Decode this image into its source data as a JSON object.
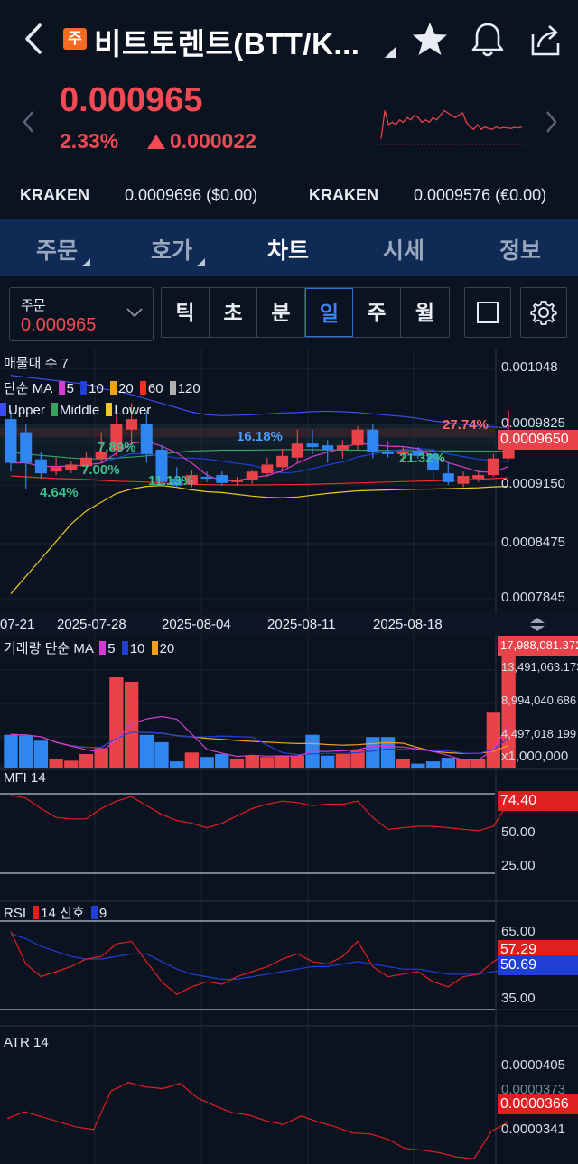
{
  "header": {
    "badge": "주",
    "title": "비트토렌트(BTT/K...",
    "price": "0.000965",
    "change_pct": "2.33%",
    "change_abs": "0.000022"
  },
  "exchanges": [
    {
      "name": "KRAKEN",
      "value": "0.0009696 ($0.00)"
    },
    {
      "name": "KRAKEN",
      "value": "0.0009576 (€0.00)"
    }
  ],
  "tabs": [
    {
      "label": "주문",
      "active": false
    },
    {
      "label": "호가",
      "active": false
    },
    {
      "label": "차트",
      "active": true
    },
    {
      "label": "시세",
      "active": false
    },
    {
      "label": "정보",
      "active": false
    }
  ],
  "order": {
    "label": "주문",
    "value": "0.000965"
  },
  "timeframes": [
    "틱",
    "초",
    "분",
    "일",
    "주",
    "월"
  ],
  "active_timeframe": "일",
  "price_panel": {
    "legend1": "매물대 수 7",
    "legend2_label": "단순 MA",
    "legend2_items": [
      {
        "n": "5",
        "color": "#d23cd0"
      },
      {
        "n": "10",
        "color": "#1f3fd6"
      },
      {
        "n": "20",
        "color": "#f0a020"
      },
      {
        "n": "60",
        "color": "#f03020"
      },
      {
        "n": "120",
        "color": "#b0b0b0"
      }
    ],
    "legend3": [
      {
        "label": "Upper",
        "color": "#3b4cf0"
      },
      {
        "label": "Middle",
        "color": "#3aa060"
      },
      {
        "label": "Lower",
        "color": "#f0c820"
      }
    ],
    "axis": [
      "0.001048",
      "0.0009825",
      "0.0009150",
      "0.0008475",
      "0.0007845"
    ],
    "current_tag": "0.0009650",
    "annotations": [
      {
        "text": "27.74%",
        "color": "#ff6a6a"
      },
      {
        "text": "16.18%",
        "color": "#4aa0ff"
      },
      {
        "text": "7.89%",
        "color": "#3cc08c"
      },
      {
        "text": "7.00%",
        "color": "#3cc08c"
      },
      {
        "text": "4.64%",
        "color": "#3cc08c"
      },
      {
        "text": "11.13%",
        "color": "#3cc08c"
      },
      {
        "text": "21.32%",
        "color": "#3cc08c"
      }
    ]
  },
  "dates": [
    "07-21",
    "2025-07-28",
    "2025-08-04",
    "2025-08-11",
    "2025-08-18"
  ],
  "volume_panel": {
    "legend_label": "거래량 단순 MA",
    "legend_items": [
      {
        "n": "5",
        "color": "#d23cd0"
      },
      {
        "n": "10",
        "color": "#1f3fd6"
      },
      {
        "n": "20",
        "color": "#f0a020"
      }
    ],
    "axis": [
      "13,491,063.173",
      "8,994,040.686",
      "4,497,018.199",
      "x1,000,000"
    ],
    "current_tag": "17,988,081.372"
  },
  "mfi_panel": {
    "legend": "MFI 14",
    "axis": [
      "50.00",
      "25.00"
    ],
    "current_tag": "74.40"
  },
  "rsi_panel": {
    "legend_label": "RSI",
    "legend_items": [
      {
        "n": "14",
        "label": "신호",
        "color": "#e02020"
      },
      {
        "n": "9",
        "label": "",
        "color": "#1f3fd6"
      }
    ],
    "axis": [
      "65.00",
      "35.00"
    ],
    "tag_rsi": "57.29",
    "tag_signal": "50.69"
  },
  "atr_panel": {
    "legend": "ATR 14",
    "axis": [
      "0.0000405",
      "0.0000341"
    ],
    "hidden_label": "0.0000373",
    "current_tag": "0.0000366"
  },
  "candles": [
    {
      "d": "07-19",
      "o": 0.00099,
      "h": 0.001,
      "l": 0.00093,
      "c": 0.00094
    },
    {
      "d": "07-20",
      "o": 0.000975,
      "h": 0.000985,
      "l": 0.00091,
      "c": 0.00094
    },
    {
      "d": "07-21",
      "o": 0.000944,
      "h": 0.000952,
      "l": 0.000922,
      "c": 0.000928
    },
    {
      "d": "07-22",
      "o": 0.00093,
      "h": 0.000946,
      "l": 0.000926,
      "c": 0.000935
    },
    {
      "d": "07-23",
      "o": 0.000932,
      "h": 0.000942,
      "l": 0.000928,
      "c": 0.000938
    },
    {
      "d": "07-24",
      "o": 0.000936,
      "h": 0.000952,
      "l": 0.00093,
      "c": 0.000946
    },
    {
      "d": "07-25",
      "o": 0.000945,
      "h": 0.000975,
      "l": 0.00094,
      "c": 0.000952
    },
    {
      "d": "07-26",
      "o": 0.000955,
      "h": 0.000995,
      "l": 0.000948,
      "c": 0.000985
    },
    {
      "d": "07-27",
      "o": 0.000978,
      "h": 0.001008,
      "l": 0.00096,
      "c": 0.00099
    },
    {
      "d": "07-28",
      "o": 0.000985,
      "h": 0.001,
      "l": 0.00094,
      "c": 0.00095
    },
    {
      "d": "07-29",
      "o": 0.000955,
      "h": 0.00096,
      "l": 0.000915,
      "c": 0.000918
    },
    {
      "d": "07-30",
      "o": 0.000922,
      "h": 0.000935,
      "l": 0.000912,
      "c": 0.000914
    },
    {
      "d": "07-31",
      "o": 0.000915,
      "h": 0.000932,
      "l": 0.000912,
      "c": 0.000926
    },
    {
      "d": "08-01",
      "o": 0.000924,
      "h": 0.00093,
      "l": 0.000918,
      "c": 0.000922
    },
    {
      "d": "08-02",
      "o": 0.000926,
      "h": 0.00093,
      "l": 0.000914,
      "c": 0.000917
    },
    {
      "d": "08-03",
      "o": 0.000918,
      "h": 0.000924,
      "l": 0.000914,
      "c": 0.00092
    },
    {
      "d": "08-04",
      "o": 0.00092,
      "h": 0.000932,
      "l": 0.000916,
      "c": 0.00093
    },
    {
      "d": "08-05",
      "o": 0.000928,
      "h": 0.000946,
      "l": 0.000924,
      "c": 0.000938
    },
    {
      "d": "08-06",
      "o": 0.000935,
      "h": 0.000955,
      "l": 0.00093,
      "c": 0.000948
    },
    {
      "d": "08-07",
      "o": 0.000946,
      "h": 0.000978,
      "l": 0.00094,
      "c": 0.000962
    },
    {
      "d": "08-08",
      "o": 0.000962,
      "h": 0.000978,
      "l": 0.00095,
      "c": 0.000958
    },
    {
      "d": "08-09",
      "o": 0.00096,
      "h": 0.000966,
      "l": 0.00094,
      "c": 0.000955
    },
    {
      "d": "08-10",
      "o": 0.000955,
      "h": 0.000966,
      "l": 0.000945,
      "c": 0.00096
    },
    {
      "d": "08-11",
      "o": 0.00096,
      "h": 0.000982,
      "l": 0.000955,
      "c": 0.000978
    },
    {
      "d": "08-12",
      "o": 0.000978,
      "h": 0.000985,
      "l": 0.000945,
      "c": 0.000952
    },
    {
      "d": "08-13",
      "o": 0.000952,
      "h": 0.000965,
      "l": 0.000946,
      "c": 0.00095
    },
    {
      "d": "08-14",
      "o": 0.00095,
      "h": 0.000958,
      "l": 0.000942,
      "c": 0.000953
    },
    {
      "d": "08-15",
      "o": 0.000954,
      "h": 0.000958,
      "l": 0.000945,
      "c": 0.000948
    },
    {
      "d": "08-16",
      "o": 0.00095,
      "h": 0.000958,
      "l": 0.00092,
      "c": 0.000932
    },
    {
      "d": "08-17",
      "o": 0.000928,
      "h": 0.00094,
      "l": 0.000915,
      "c": 0.000918
    },
    {
      "d": "08-18",
      "o": 0.000916,
      "h": 0.00093,
      "l": 0.000912,
      "c": 0.000925
    },
    {
      "d": "08-19",
      "o": 0.000922,
      "h": 0.000932,
      "l": 0.000918,
      "c": 0.000926
    },
    {
      "d": "08-20",
      "o": 0.000926,
      "h": 0.00095,
      "l": 0.000924,
      "c": 0.000945
    },
    {
      "d": "08-21",
      "o": 0.000945,
      "h": 0.001,
      "l": 0.000943,
      "c": 0.000965
    }
  ],
  "volumes": [
    4.6,
    4.5,
    3.8,
    1.3,
    1.1,
    2.0,
    2.8,
    12.4,
    11.8,
    4.6,
    3.6,
    1.0,
    2.2,
    1.6,
    2.0,
    1.4,
    1.8,
    1.6,
    1.8,
    1.8,
    4.6,
    1.8,
    2.0,
    2.6,
    4.3,
    4.3,
    1.3,
    0.7,
    1.0,
    1.5,
    1.3,
    1.3,
    7.6,
    18.0
  ],
  "mfi": [
    79,
    77,
    70,
    64,
    63,
    63,
    70,
    75,
    78,
    72,
    66,
    62,
    60,
    57,
    60,
    65,
    70,
    73,
    75,
    74,
    72,
    73,
    73,
    75,
    64,
    56,
    57,
    58,
    58,
    57,
    56,
    55,
    58,
    74.4
  ],
  "rsi": [
    66,
    53,
    48,
    50,
    52,
    55,
    56,
    61,
    62,
    54,
    46,
    41,
    44,
    46,
    45,
    48,
    50,
    52,
    55,
    57,
    54,
    53,
    56,
    62,
    52,
    48,
    49,
    50,
    46,
    44,
    48,
    49,
    54,
    57.29
  ],
  "rsi_signal": [
    65,
    63,
    60,
    58,
    56,
    55,
    55,
    56,
    57,
    57,
    54,
    51,
    49,
    48,
    47,
    47,
    48,
    49,
    50,
    51,
    52,
    52,
    53,
    54,
    53,
    52,
    51,
    51,
    50,
    49,
    49,
    49,
    50,
    50.69
  ],
  "atr": [
    37.0,
    37.8,
    37.2,
    36.6,
    36.0,
    35.7,
    40.2,
    41.2,
    40.7,
    40.5,
    41.1,
    39.4,
    38.5,
    37.7,
    37.4,
    36.7,
    36.3,
    37.3,
    36.6,
    36.0,
    35.3,
    35.2,
    34.6,
    33.5,
    33.3,
    33.0,
    32.5,
    32.3,
    35.5,
    36.6
  ],
  "spark": [
    0.2,
    0.8,
    0.5,
    0.55,
    0.5,
    0.6,
    0.55,
    0.65,
    0.6,
    0.7,
    0.65,
    0.55,
    0.6,
    0.55,
    0.65,
    0.6,
    0.7,
    0.8,
    0.75,
    0.7,
    0.65,
    0.7,
    0.75,
    0.55,
    0.45,
    0.4,
    0.5,
    0.4,
    0.45,
    0.42,
    0.4,
    0.45,
    0.42,
    0.44,
    0.43,
    0.42,
    0.44,
    0.43,
    0.45
  ]
}
